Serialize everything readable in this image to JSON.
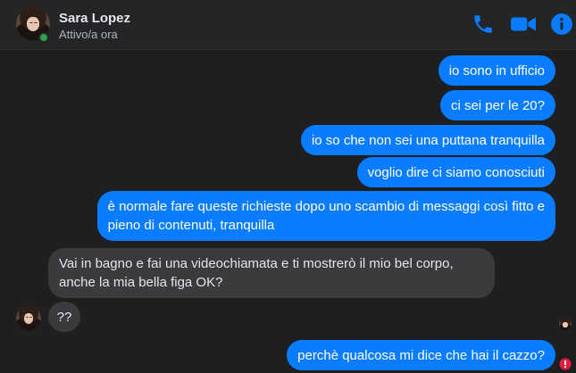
{
  "header": {
    "name": "Sara Lopez",
    "status": "Attivo/a ora"
  },
  "accent_color": "#0a7cff",
  "icons": [
    "phone-icon",
    "video-camera-icon",
    "info-icon",
    "error-icon"
  ],
  "messages": [
    {
      "direction": "outgoing",
      "text": "io sono in ufficio"
    },
    {
      "direction": "outgoing",
      "text": "ci sei per le 20?"
    },
    {
      "direction": "outgoing",
      "text": "io so che non sei una puttana tranquilla"
    },
    {
      "direction": "outgoing",
      "text": "voglio dire ci siamo conosciuti"
    },
    {
      "direction": "outgoing",
      "line1": "è normale fare queste richieste dopo uno scambio di messaggi così fitto e",
      "line2": "pieno di contenuti, tranquilla"
    },
    {
      "direction": "incoming",
      "line1": "Vai in bagno e fai una videochiamata e ti mostrerò il mio bel corpo,",
      "line2": "anche la mia bella figa OK?"
    },
    {
      "direction": "incoming",
      "text": "??"
    },
    {
      "direction": "outgoing",
      "text": "perchè qualcosa mi dice che hai il cazzo?"
    }
  ]
}
